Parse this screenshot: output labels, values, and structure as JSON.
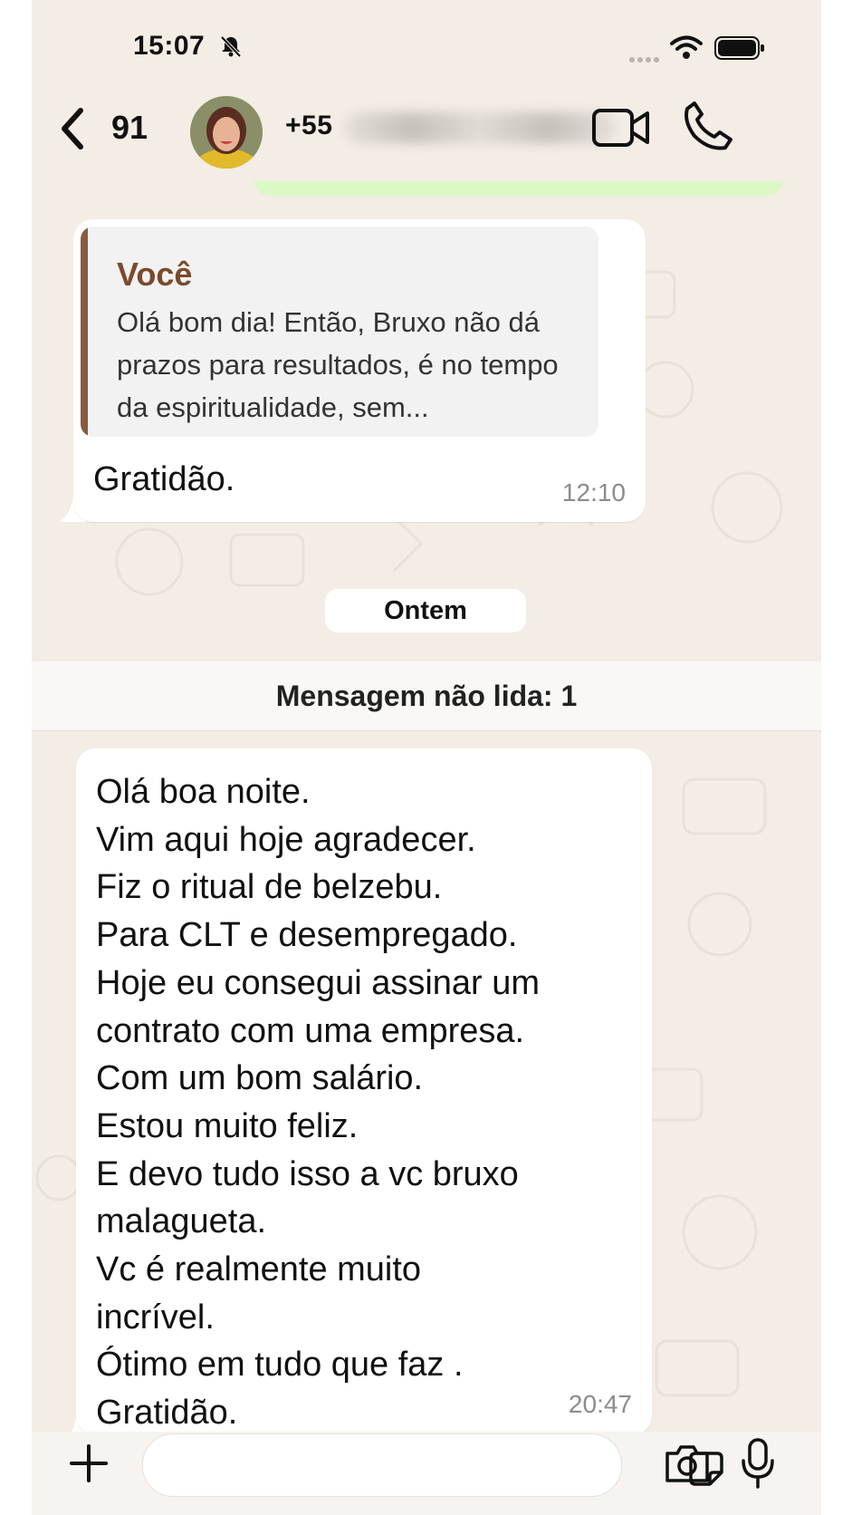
{
  "status_bar": {
    "time": "15:07"
  },
  "header": {
    "unread_count": "91",
    "contact_name": "+55"
  },
  "messages": {
    "quoted": {
      "author": "Você",
      "text": "Olá bom dia! Então, Bruxo não dá prazos para resultados, é no tempo da espiritualidade, sem..."
    },
    "reply": {
      "text": "Gratidão.",
      "time": "12:10"
    },
    "date_separator": "Ontem",
    "unread_banner": "Mensagem não lida: 1",
    "incoming": {
      "lines": [
        "Olá boa noite.",
        "Vim aqui hoje agradecer.",
        "Fiz o ritual de belzebu.",
        "Para CLT e desempregado.",
        "Hoje eu consegui assinar um",
        "contrato com uma empresa.",
        "Com um bom salário.",
        "Estou muito feliz.",
        "E devo tudo isso a vc bruxo",
        "malagueta.",
        "Vc é realmente muito",
        "incrível.",
        "Ótimo em tudo que faz .",
        "Gratidão."
      ],
      "time": "20:47"
    }
  },
  "icons": {
    "status": [
      "bell-off-icon",
      "signal-dots-icon",
      "wifi-icon",
      "battery-icon"
    ],
    "header": [
      "back-icon",
      "video-call-icon",
      "voice-call-icon"
    ],
    "input": [
      "plus-icon",
      "sticker-icon",
      "camera-icon",
      "mic-icon"
    ]
  },
  "colors": {
    "chat_background": "#f3ede5",
    "bubble_incoming": "#ffffff",
    "bubble_outgoing": "#dcf8c6",
    "quote_bar": "#8a5a3b",
    "quote_author": "#7a4a2c"
  }
}
